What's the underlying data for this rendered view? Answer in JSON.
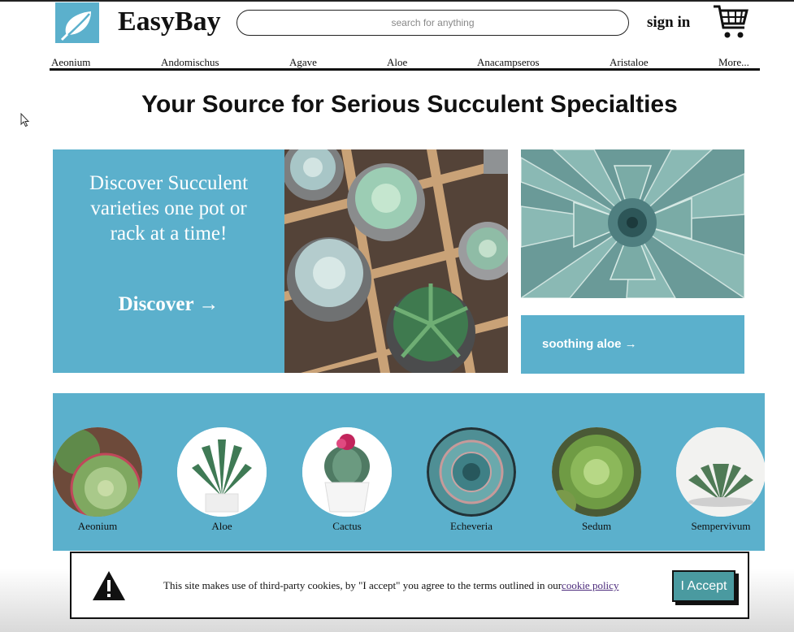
{
  "header": {
    "brand": "EasyBay",
    "search_placeholder": "search for anything",
    "signin": "sign in"
  },
  "nav": [
    "Aeonium",
    "Andomischus",
    "Agave",
    "Aloe",
    "Anacampseros",
    "Aristaloe",
    "More..."
  ],
  "headline": "Your Source for Serious Succulent Specialties",
  "promo": {
    "text": "Discover Succulent varieties one pot or rack at a time!",
    "cta": "Discover →"
  },
  "aloe_card": "soothing aloe →",
  "categories": [
    "Aeonium",
    "Aloe",
    "Cactus",
    "Echeveria",
    "Sedum",
    "Sempervivum"
  ],
  "cookie": {
    "text": "This site makes use of third-party cookies, by \"I accept\" you agree to the terms outlined in our",
    "link": "cookie policy",
    "accept": "I Accept"
  },
  "colors": {
    "accent": "#5bb0cc",
    "accept_button": "#4a9aa0"
  }
}
